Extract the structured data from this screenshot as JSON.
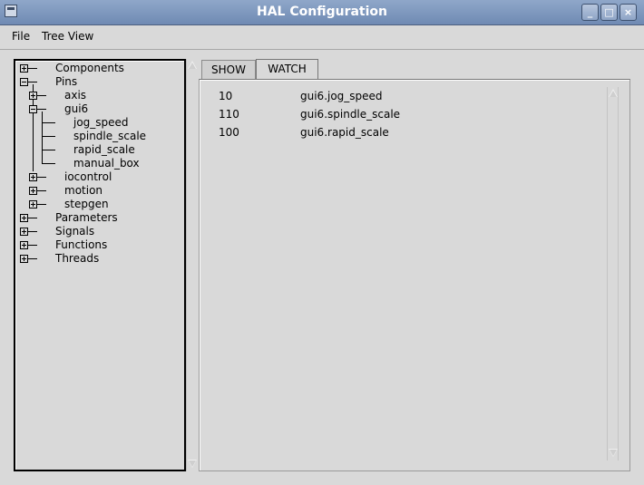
{
  "window": {
    "title": "HAL Configuration"
  },
  "menu": {
    "items": [
      "File",
      "Tree View"
    ]
  },
  "tree": {
    "nodes": [
      {
        "label": "Components",
        "level": 0,
        "expander": "plus"
      },
      {
        "label": "Pins",
        "level": 0,
        "expander": "minus"
      },
      {
        "label": "axis",
        "level": 1,
        "expander": "plus"
      },
      {
        "label": "gui6",
        "level": 1,
        "expander": "minus"
      },
      {
        "label": "jog_speed",
        "level": 2,
        "expander": "none"
      },
      {
        "label": "spindle_scale",
        "level": 2,
        "expander": "none"
      },
      {
        "label": "rapid_scale",
        "level": 2,
        "expander": "none"
      },
      {
        "label": "manual_box",
        "level": 2,
        "expander": "none"
      },
      {
        "label": "iocontrol",
        "level": 1,
        "expander": "plus"
      },
      {
        "label": "motion",
        "level": 1,
        "expander": "plus"
      },
      {
        "label": "stepgen",
        "level": 1,
        "expander": "plus"
      },
      {
        "label": "Parameters",
        "level": 0,
        "expander": "plus"
      },
      {
        "label": "Signals",
        "level": 0,
        "expander": "plus"
      },
      {
        "label": "Functions",
        "level": 0,
        "expander": "plus"
      },
      {
        "label": "Threads",
        "level": 0,
        "expander": "plus"
      }
    ]
  },
  "tabs": [
    {
      "label": "SHOW",
      "active": false
    },
    {
      "label": "WATCH",
      "active": true
    }
  ],
  "watch": {
    "rows": [
      {
        "value": "10",
        "name": "gui6.jog_speed"
      },
      {
        "value": "110",
        "name": "gui6.spindle_scale"
      },
      {
        "value": "100",
        "name": "gui6.rapid_scale"
      }
    ]
  }
}
